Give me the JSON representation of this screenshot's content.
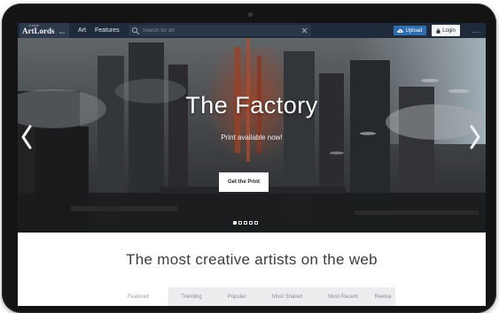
{
  "nav": {
    "logo_small": "create",
    "logo_main": "ArtLords",
    "logo_sub": "Beta",
    "links": [
      "Art",
      "Features"
    ],
    "search_placeholder": "Search for art",
    "upload_label": "Upload",
    "login_label": "Login",
    "more_label": "..."
  },
  "hero": {
    "title": "The Factory",
    "subtitle": "Print available now!",
    "cta_label": "Get the Print",
    "slide_count": 5,
    "active_slide": 1
  },
  "content": {
    "headline": "The most creative artists on the web",
    "tabs": [
      {
        "label": "Featured",
        "active": true
      },
      {
        "label": "Trending",
        "active": false
      },
      {
        "label": "Popular",
        "active": false
      },
      {
        "label": "Most Shared",
        "active": false
      },
      {
        "label": "Most Recent",
        "active": false
      },
      {
        "label": "Reelva",
        "active": false
      }
    ]
  },
  "colors": {
    "nav_bg": "#1f2a3a",
    "upload_bg": "#2f6fb0",
    "accent_glow": "#c0502e"
  },
  "icons": {
    "search": "search-icon",
    "clear": "close-icon",
    "upload": "cloud-upload-icon",
    "login": "lock-icon",
    "more": "more-dots-icon",
    "prev": "chevron-left-icon",
    "next": "chevron-right-icon"
  }
}
